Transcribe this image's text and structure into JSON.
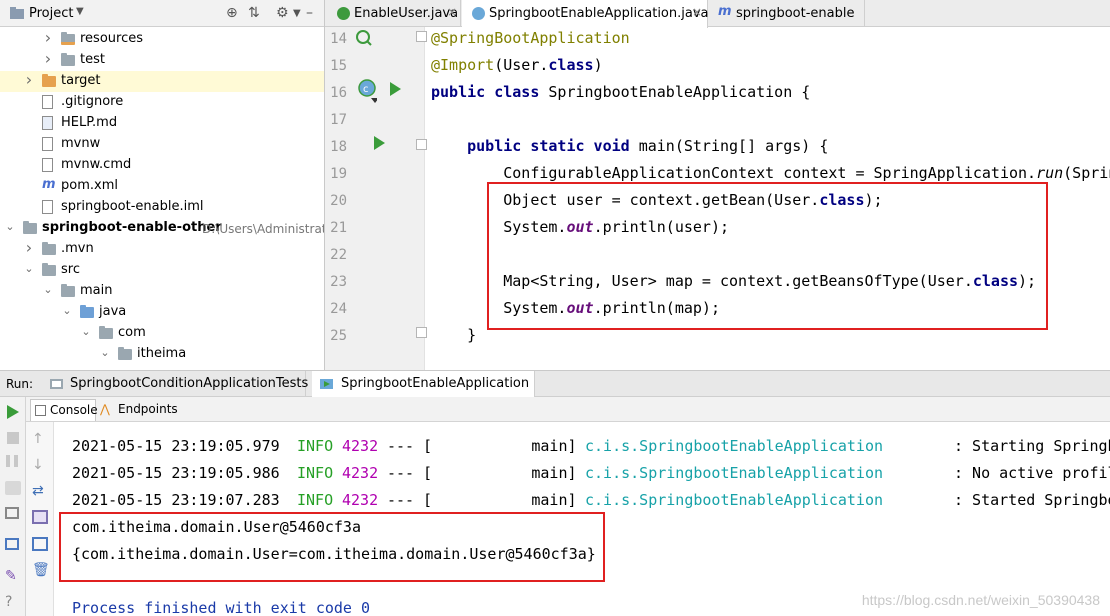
{
  "project_panel": {
    "title": "Project",
    "tree": [
      {
        "label": "resources",
        "arrow": "right",
        "icon": "folder-resources-icon",
        "level": 3
      },
      {
        "label": "test",
        "arrow": "right",
        "icon": "folder-icon",
        "level": 3
      },
      {
        "label": "target",
        "arrow": "right",
        "icon": "folder-target-icon",
        "level": 2,
        "selected": true
      },
      {
        "label": ".gitignore",
        "icon": "text-file-icon",
        "level": 2
      },
      {
        "label": "HELP.md",
        "icon": "markdown-file-icon",
        "level": 2
      },
      {
        "label": "mvnw",
        "icon": "text-file-icon",
        "level": 2
      },
      {
        "label": "mvnw.cmd",
        "icon": "text-file-icon",
        "level": 2
      },
      {
        "label": "pom.xml",
        "icon": "maven-file-icon",
        "level": 2
      },
      {
        "label": "springboot-enable.iml",
        "icon": "iml-file-icon",
        "level": 2
      },
      {
        "label": "springboot-enable-other",
        "path": "D:\\Users\\Administrato",
        "arrow": "down",
        "icon": "module-folder-icon",
        "level": 1,
        "bold": true
      },
      {
        "label": ".mvn",
        "arrow": "right",
        "icon": "folder-icon",
        "level": 2
      },
      {
        "label": "src",
        "arrow": "down",
        "icon": "folder-icon",
        "level": 2
      },
      {
        "label": "main",
        "arrow": "down",
        "icon": "folder-icon",
        "level": 3
      },
      {
        "label": "java",
        "arrow": "down",
        "icon": "folder-source-icon",
        "level": 4
      },
      {
        "label": "com",
        "arrow": "down",
        "icon": "package-icon",
        "level": 5
      },
      {
        "label": "itheima",
        "arrow": "down",
        "icon": "package-icon",
        "level": 6
      }
    ]
  },
  "editor": {
    "tabs": [
      {
        "label": "EnableUser.java",
        "icon": "annotation-icon",
        "close": "×"
      },
      {
        "label": "SpringbootEnableApplication.java",
        "icon": "spring-class-icon",
        "close": "×",
        "active": true
      },
      {
        "label": "springboot-enable",
        "icon": "maven-icon"
      }
    ],
    "line_numbers": [
      "14",
      "15",
      "16",
      "17",
      "18",
      "19",
      "20",
      "21",
      "22",
      "23",
      "24",
      "25"
    ]
  },
  "run_panel": {
    "label": "Run:",
    "tabs": [
      {
        "label": "SpringbootConditionApplicationTests",
        "close": "×"
      },
      {
        "label": "SpringbootEnableApplication",
        "close": "×",
        "active": true
      }
    ],
    "console_tabs": [
      {
        "label": "Console",
        "active": true
      },
      {
        "label": "Endpoints"
      }
    ],
    "log_lines": [
      {
        "ts": "2021-05-15 23:19:05.979",
        "level": "INFO",
        "pid": "4232",
        "sep": "---",
        "thread": "[           main]",
        "logger": "c.i.s.SpringbootEnableApplication",
        "msg": ": Starting Springb"
      },
      {
        "ts": "2021-05-15 23:19:05.986",
        "level": "INFO",
        "pid": "4232",
        "sep": "---",
        "thread": "[           main]",
        "logger": "c.i.s.SpringbootEnableApplication",
        "msg": ": No active profil"
      },
      {
        "ts": "2021-05-15 23:19:07.283",
        "level": "INFO",
        "pid": "4232",
        "sep": "---",
        "thread": "[           main]",
        "logger": "c.i.s.SpringbootEnableApplication",
        "msg": ": Started Springbo"
      }
    ],
    "output_lines": [
      "com.itheima.domain.User@5460cf3a",
      "{com.itheima.domain.User=com.itheima.domain.User@5460cf3a}"
    ],
    "exit_message": "Process finished with exit code 0"
  },
  "watermark": "https://blog.csdn.net/weixin_50390438",
  "colors": {
    "highlight_box": "#e02020",
    "annotation": "#808000",
    "keyword": "#000080",
    "info": "#26a026",
    "logger": "#17a2a8"
  }
}
